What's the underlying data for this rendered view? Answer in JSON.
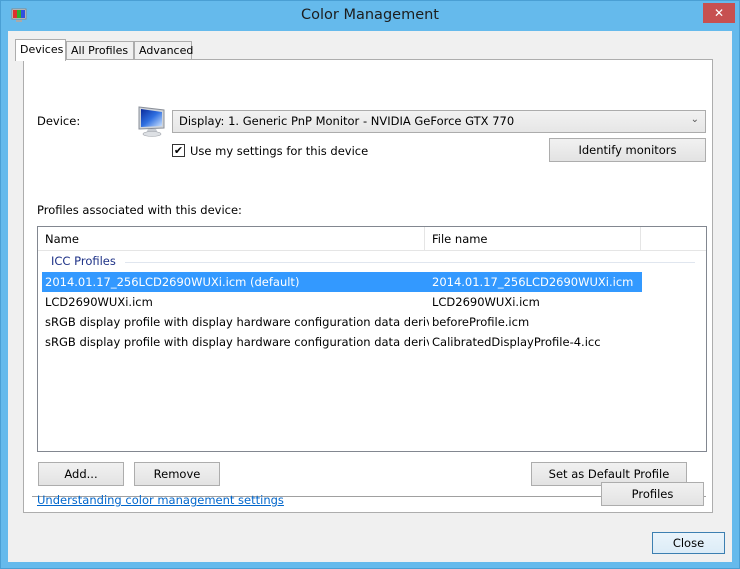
{
  "window": {
    "title": "Color Management",
    "close_glyph": "✕"
  },
  "tabs": [
    {
      "label": "Devices",
      "active": true
    },
    {
      "label": "All Profiles",
      "active": false
    },
    {
      "label": "Advanced",
      "active": false
    }
  ],
  "device": {
    "label": "Device:",
    "selected": "Display: 1. Generic PnP Monitor - NVIDIA GeForce GTX 770",
    "dropdown_glyph": "⌄",
    "use_my_settings_label": "Use my settings for this device",
    "use_my_settings_checked": true,
    "check_glyph": "✔",
    "identify_button": "Identify monitors"
  },
  "profiles": {
    "section_label": "Profiles associated with this device:",
    "columns": [
      "Name",
      "File name"
    ],
    "group": "ICC Profiles",
    "rows": [
      {
        "name": "2014.01.17_256LCD2690WUXi.icm (default)",
        "file": "2014.01.17_256LCD2690WUXi.icm",
        "selected": true
      },
      {
        "name": "LCD2690WUXi.icm",
        "file": "LCD2690WUXi.icm",
        "selected": false
      },
      {
        "name": "sRGB display profile with display hardware configuration data derived ...",
        "file": "beforeProfile.icm",
        "selected": false
      },
      {
        "name": "sRGB display profile with display hardware configuration data derived ...",
        "file": "CalibratedDisplayProfile-4.icc",
        "selected": false
      }
    ],
    "add_button": "Add...",
    "remove_button": "Remove",
    "set_default_button": "Set as Default Profile"
  },
  "footer": {
    "help_link": "Understanding color management settings",
    "profiles_button": "Profiles",
    "close_button": "Close"
  },
  "colors": {
    "titlebar": "#65baec",
    "close_button": "#c75050",
    "selection": "#3399ff",
    "group_text": "#1e3287",
    "link": "#0066cc"
  }
}
